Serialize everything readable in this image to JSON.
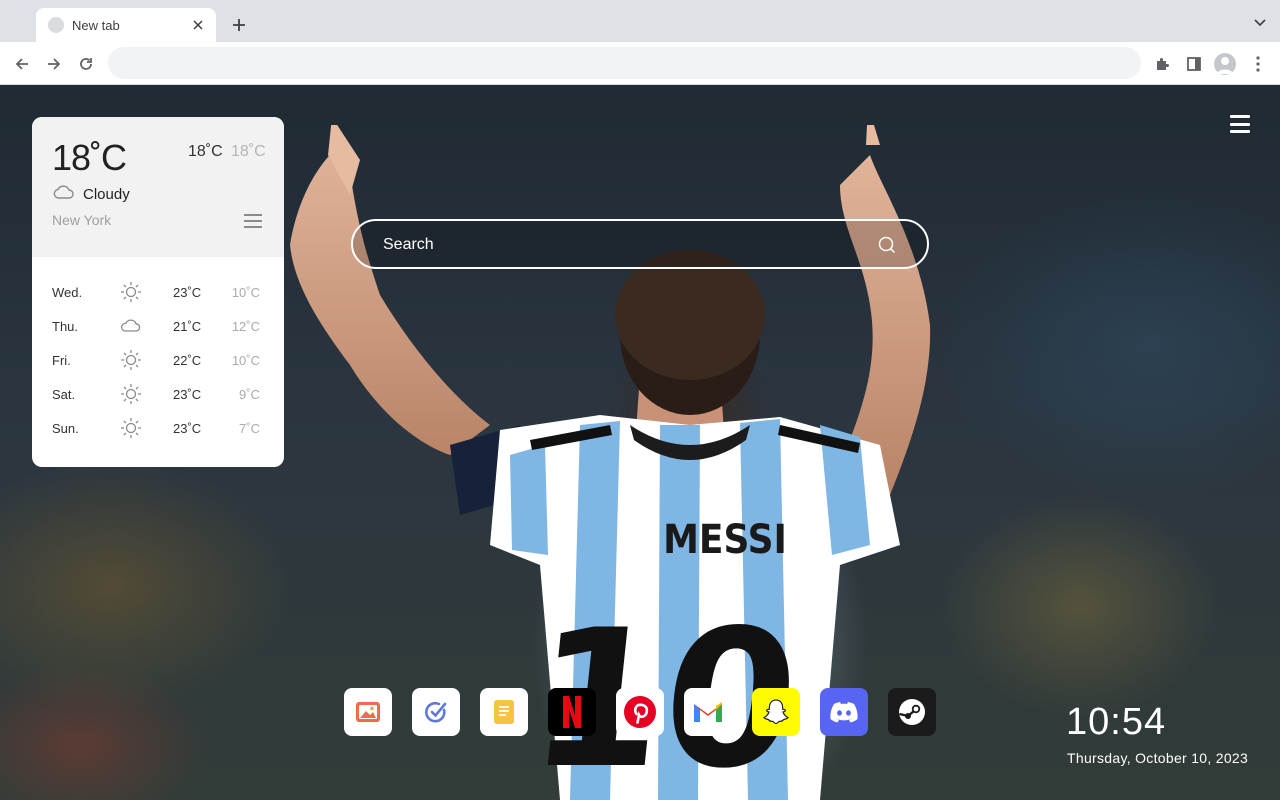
{
  "browser": {
    "tab": {
      "title": "New tab",
      "favicon": "globe-placeholder-icon"
    },
    "toolbar": {
      "address_value": "",
      "icons": [
        "back-arrow-icon",
        "forward-arrow-icon",
        "reload-icon",
        "extensions-puzzle-icon",
        "side-panel-icon",
        "profile-avatar-icon",
        "more-vert-icon"
      ]
    }
  },
  "weather": {
    "current_temp": "18˚C",
    "high": "18˚C",
    "low": "18˚C",
    "condition": "Cloudy",
    "condition_icon": "cloud-icon",
    "city": "New York",
    "forecast": [
      {
        "day": "Wed.",
        "icon": "sun-icon",
        "high": "23˚C",
        "low": "10˚C"
      },
      {
        "day": "Thu.",
        "icon": "cloud-icon",
        "high": "21˚C",
        "low": "12˚C"
      },
      {
        "day": "Fri.",
        "icon": "sun-icon",
        "high": "22˚C",
        "low": "10˚C"
      },
      {
        "day": "Sat.",
        "icon": "sun-icon",
        "high": "23˚C",
        "low": "9˚C"
      },
      {
        "day": "Sun.",
        "icon": "sun-icon",
        "high": "23˚C",
        "low": "7˚C"
      }
    ]
  },
  "search": {
    "placeholder": "Search"
  },
  "jersey": {
    "name": "MESSI",
    "number": "10"
  },
  "dock": {
    "apps": [
      {
        "name": "gallery",
        "icon": "image-gallery-icon",
        "bg": "#ffffff"
      },
      {
        "name": "tasks",
        "icon": "task-check-icon",
        "bg": "#ffffff"
      },
      {
        "name": "notes",
        "icon": "notes-icon",
        "bg": "#ffffff"
      },
      {
        "name": "netflix",
        "icon": "netflix-icon",
        "bg": "#000000",
        "letter": "N"
      },
      {
        "name": "pinterest",
        "icon": "pinterest-icon",
        "bg": "#ffffff"
      },
      {
        "name": "gmail",
        "icon": "gmail-icon",
        "bg": "#ffffff"
      },
      {
        "name": "snapchat",
        "icon": "snapchat-icon",
        "bg": "#fffc00"
      },
      {
        "name": "discord",
        "icon": "discord-icon",
        "bg": "#5865f2"
      },
      {
        "name": "steam",
        "icon": "steam-icon",
        "bg": "#1b1b1b"
      }
    ]
  },
  "clock": {
    "time": "10:54",
    "date": "Thursday, October 10, 2023"
  },
  "colors": {
    "accent_blue": "#6d8fd6",
    "netflix_red": "#e50914",
    "pinterest_red": "#e60023",
    "snapchat_yellow": "#fffc00",
    "discord_blurple": "#5865f2"
  }
}
